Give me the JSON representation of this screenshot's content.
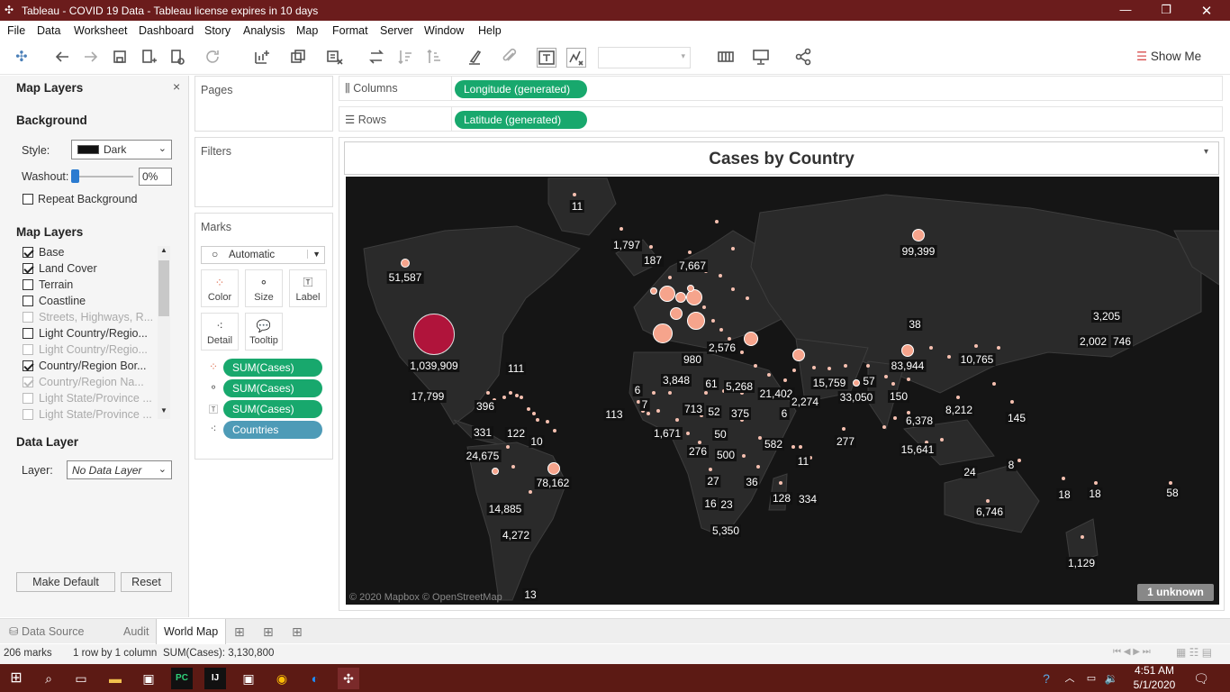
{
  "window": {
    "title": "Tableau - COVID 19 Data - Tableau license expires in 10 days"
  },
  "menu": [
    "File",
    "Data",
    "Worksheet",
    "Dashboard",
    "Story",
    "Analysis",
    "Map",
    "Format",
    "Server",
    "Window",
    "Help"
  ],
  "toolbar": {
    "show_me": "Show Me"
  },
  "left_panel": {
    "title": "Map Layers",
    "background_heading": "Background",
    "style_label": "Style:",
    "style_value": "Dark",
    "washout_label": "Washout:",
    "washout_value": "0%",
    "repeat_background": "Repeat Background",
    "layers_heading": "Map Layers",
    "layers": [
      {
        "label": "Base",
        "checked": true,
        "enabled": true
      },
      {
        "label": "Land Cover",
        "checked": true,
        "enabled": true
      },
      {
        "label": "Terrain",
        "checked": false,
        "enabled": true
      },
      {
        "label": "Coastline",
        "checked": false,
        "enabled": true
      },
      {
        "label": "Streets, Highways, R...",
        "checked": false,
        "enabled": false
      },
      {
        "label": "Light Country/Regio...",
        "checked": false,
        "enabled": true
      },
      {
        "label": "Light Country/Regio...",
        "checked": false,
        "enabled": false
      },
      {
        "label": "Country/Region Bor...",
        "checked": true,
        "enabled": true
      },
      {
        "label": "Country/Region Na...",
        "checked": true,
        "enabled": false
      },
      {
        "label": "Light State/Province ...",
        "checked": false,
        "enabled": false
      },
      {
        "label": "Light State/Province ...",
        "checked": false,
        "enabled": false
      }
    ],
    "data_layer_heading": "Data Layer",
    "layer_label": "Layer:",
    "layer_value": "No Data Layer",
    "make_default": "Make Default",
    "reset": "Reset"
  },
  "cards": {
    "pages": "Pages",
    "filters": "Filters",
    "marks": "Marks",
    "mark_type": "Automatic",
    "mark_buttons": [
      "Color",
      "Size",
      "Label",
      "Detail",
      "Tooltip"
    ],
    "pills": [
      "SUM(Cases)",
      "SUM(Cases)",
      "SUM(Cases)",
      "Countries"
    ]
  },
  "shelves": {
    "columns_label": "Columns",
    "columns_pill": "Longitude (generated)",
    "rows_label": "Rows",
    "rows_pill": "Latitude (generated)"
  },
  "viz": {
    "title": "Cases by Country",
    "attribution": "© 2020 Mapbox © OpenStreetMap",
    "unknown": "1 unknown"
  },
  "map_labels": [
    "11",
    "1,797",
    "187",
    "7,667",
    "99,399",
    "51,587",
    "3,205",
    "38",
    "2,576",
    "1,039,909",
    "980",
    "2,002",
    "746",
    "83,944",
    "10,765",
    "111",
    "3,848",
    "61",
    "5,268",
    "21,402",
    "15,759",
    "57",
    "17,799",
    "6",
    "7",
    "33,050",
    "150",
    "2,274",
    "396",
    "713",
    "52",
    "375",
    "6",
    "8,212",
    "145",
    "113",
    "122",
    "6,378",
    "331",
    "1,671",
    "50",
    "582",
    "277",
    "10",
    "24,675",
    "276",
    "500",
    "11",
    "15,641",
    "78,162",
    "24",
    "8",
    "27",
    "36",
    "16",
    "23",
    "128",
    "334",
    "14,885",
    "18",
    "18",
    "58",
    "6,746",
    "5,350",
    "4,272",
    "1,129",
    "13"
  ],
  "tabs": {
    "data_source": "Data Source",
    "audit": "Audit",
    "world_map": "World Map"
  },
  "status": {
    "marks": "206 marks",
    "rows": "1 row by 1 column",
    "sum": "SUM(Cases): 3,130,800"
  },
  "clock": {
    "time": "4:51 AM",
    "date": "5/1/2020"
  }
}
